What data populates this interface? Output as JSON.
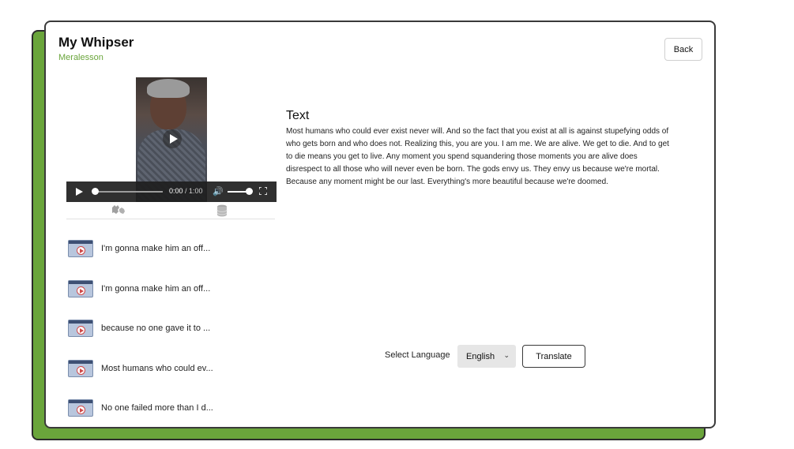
{
  "header": {
    "title": "My Whipser",
    "subtitle": "Meralesson",
    "back_label": "Back"
  },
  "video": {
    "current_time": "0:00",
    "duration": "/ 1:00",
    "progress": 0,
    "volume": 1
  },
  "tabs": [
    {
      "icon": "sign-language-icon"
    },
    {
      "icon": "database-icon"
    }
  ],
  "list": [
    {
      "label": "I'm gonna make him an off..."
    },
    {
      "label": "I'm gonna make him an off..."
    },
    {
      "label": "because no one gave it to ..."
    },
    {
      "label": "Most humans who could ev..."
    },
    {
      "label": "No one failed more than I d..."
    }
  ],
  "content": {
    "heading": "Text",
    "body": "Most humans who could ever exist never will. And so the fact that you exist at all is against stupefying odds of who gets born and who does not. Realizing this, you are you. I am me. We are alive. We get to die. And to get to die means you get to live. Any moment you spend squandering those moments you are alive does disrespect to all those who will never even be born. The gods envy us. They envy us because we're mortal. Because any moment might be our last. Everything's more beautiful because we're doomed."
  },
  "translate": {
    "label": "Select Language",
    "selected_language": "English",
    "button_label": "Translate"
  },
  "colors": {
    "accent": "#6aa53b"
  }
}
